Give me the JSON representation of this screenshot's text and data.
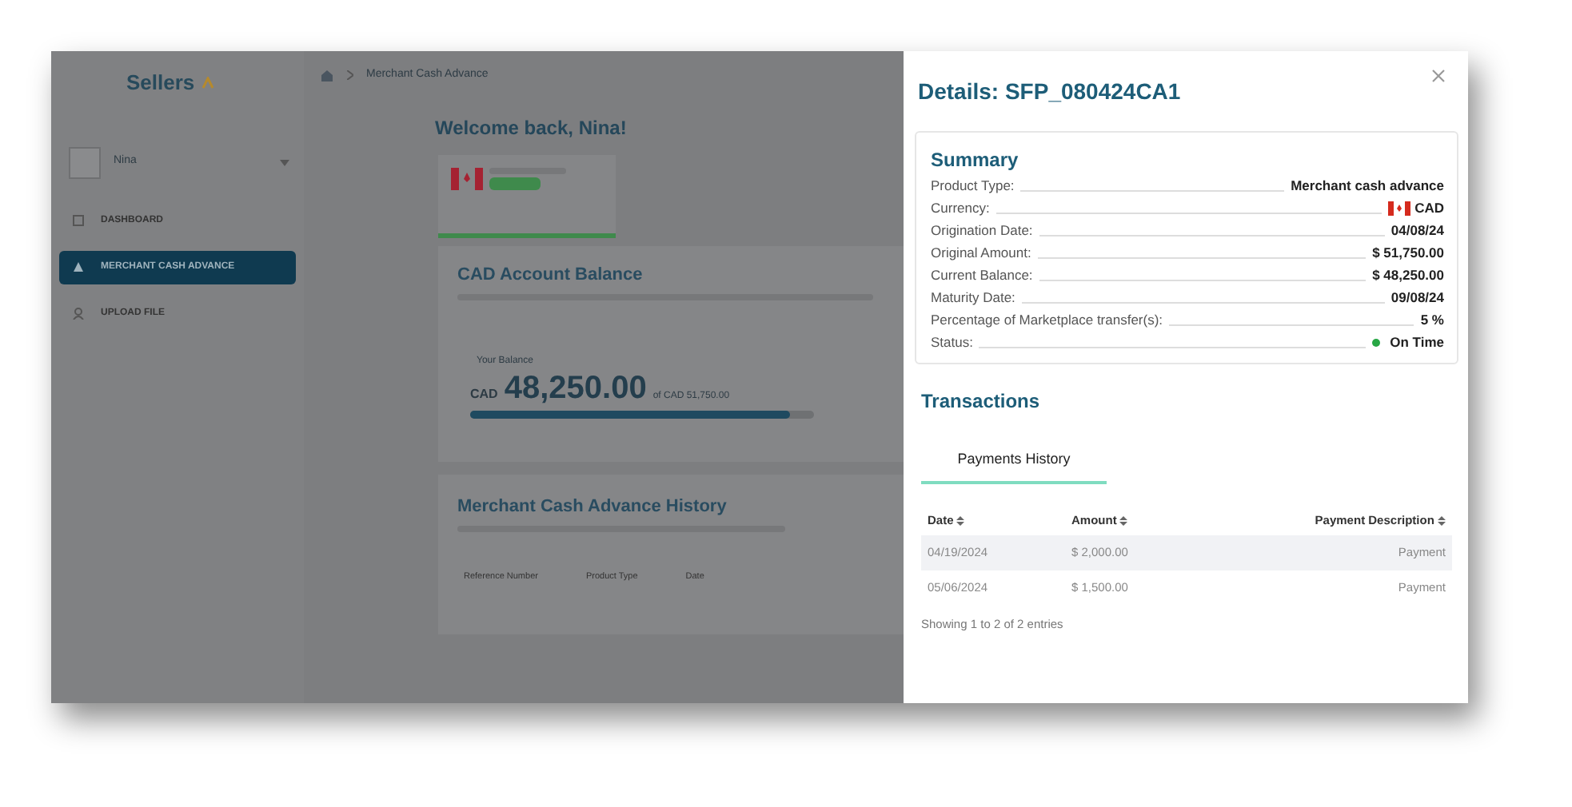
{
  "background": {
    "logo": "Sellers",
    "user": "Nina",
    "nav": [
      {
        "label": "DASHBOARD",
        "selected": false
      },
      {
        "label": "MERCHANT CASH ADVANCE",
        "selected": true
      },
      {
        "label": "UPLOAD FILE",
        "selected": false
      }
    ],
    "breadcrumb": "Merchant Cash Advance",
    "welcome": "Welcome back, Nina!",
    "balance": {
      "title": "CAD Account Balance",
      "caption": "Your Balance",
      "currency": "CAD",
      "amount": "48,250.00",
      "total": "of CAD 51,750.00",
      "level": 0.93
    },
    "history": {
      "title": "Merchant Cash Advance History",
      "columns": [
        "Reference Number",
        "Product Type",
        "Date"
      ]
    }
  },
  "panel": {
    "title": "Details: SFP_080424CA1",
    "summary": {
      "title": "Summary",
      "rows": [
        {
          "label": "Product Type:",
          "value": "Merchant cash advance",
          "kind": "text"
        },
        {
          "label": "Currency:",
          "value": "CAD",
          "kind": "flag"
        },
        {
          "label": "Origination Date:",
          "value": "04/08/24",
          "kind": "text"
        },
        {
          "label": "Original Amount:",
          "value": "$ 51,750.00",
          "kind": "text"
        },
        {
          "label": "Current Balance:",
          "value": "$ 48,250.00",
          "kind": "text"
        },
        {
          "label": "Maturity Date:",
          "value": "09/08/24",
          "kind": "text"
        },
        {
          "label": "Percentage of Marketplace transfer(s):",
          "value": "5 %",
          "kind": "text"
        },
        {
          "label": "Status:",
          "value": "On Time",
          "kind": "status",
          "color": "#28a745"
        }
      ]
    },
    "transactions": {
      "title": "Transactions",
      "tabs": [
        {
          "label": "Payments History",
          "selected": true
        }
      ],
      "columns": [
        "Date",
        "Amount",
        "Payment Description"
      ],
      "rows": [
        [
          "04/19/2024",
          "$ 2,000.00",
          "Payment"
        ],
        [
          "05/06/2024",
          "$ 1,500.00",
          "Payment"
        ]
      ],
      "footer": "Showing 1 to 2 of 2 entries"
    }
  }
}
